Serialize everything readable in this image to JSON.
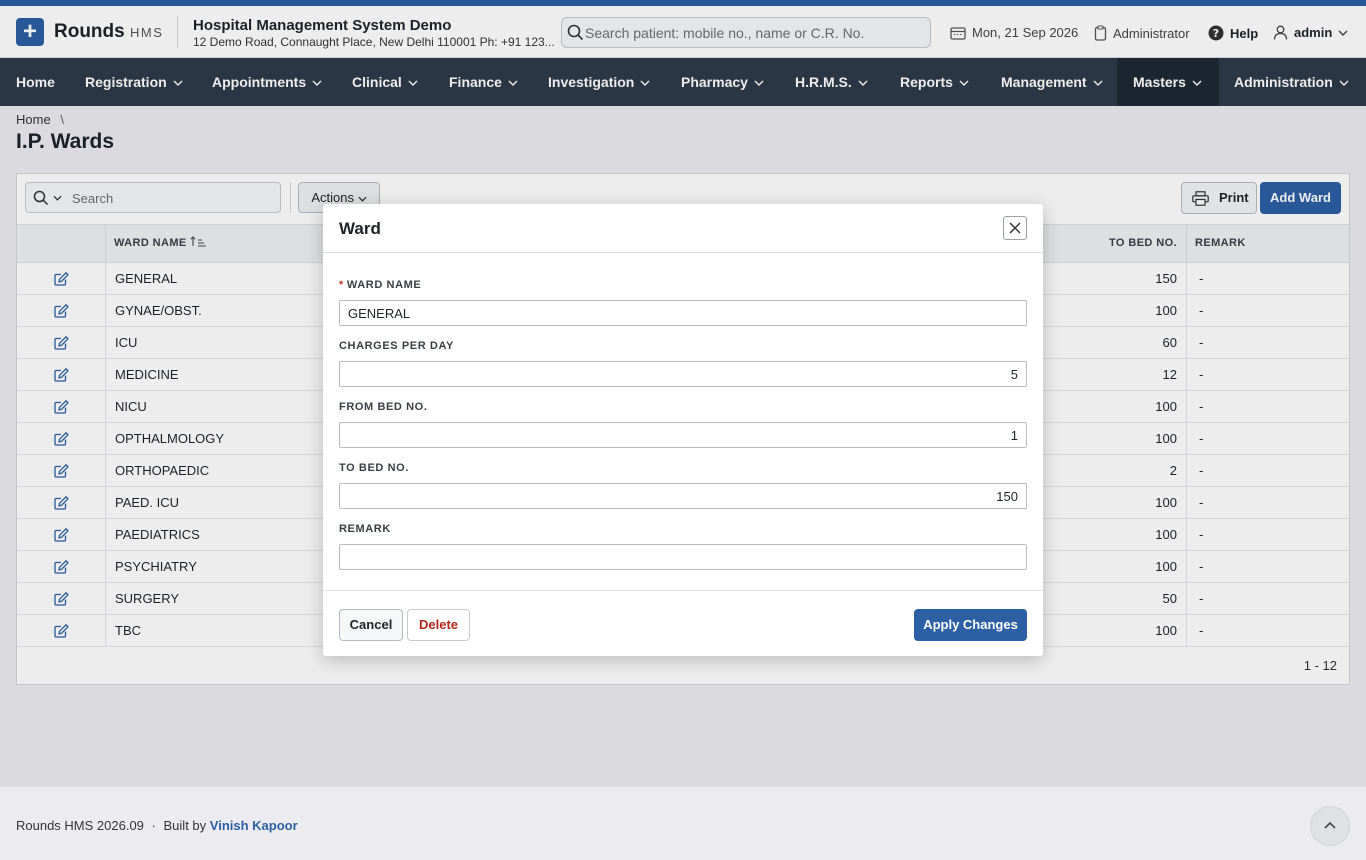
{
  "header": {
    "brand": "Rounds",
    "brand_sub": "HMS",
    "org_title": "Hospital Management System Demo",
    "org_address": "12 Demo Road, Connaught Place, New Delhi 110001 Ph: +91 123...",
    "search_placeholder": "Search patient: mobile no., name or C.R. No.",
    "date": "Mon, 21 Sep 2026",
    "role": "Administrator",
    "help": "Help",
    "user": "admin",
    "accent_color": "#2c5fa3"
  },
  "nav": {
    "items": [
      "Home",
      "Registration",
      "Appointments",
      "Clinical",
      "Finance",
      "Investigation",
      "Pharmacy",
      "H.R.M.S.",
      "Reports",
      "Management",
      "Masters",
      "Administration"
    ],
    "active": "Masters"
  },
  "page": {
    "breadcrumb_home": "Home",
    "breadcrumb_sep": "\\",
    "title": "I.P. Wards"
  },
  "toolbar": {
    "search_placeholder": "Search",
    "actions_label": "Actions",
    "print_label": "Print",
    "add_label": "Add Ward"
  },
  "table": {
    "columns": [
      "WARD NAME",
      "TO BED NO.",
      "REMARK"
    ],
    "rows": [
      {
        "name": "GENERAL",
        "to_bed": "150",
        "remark": "-"
      },
      {
        "name": "GYNAE/OBST.",
        "to_bed": "100",
        "remark": "-"
      },
      {
        "name": "ICU",
        "to_bed": "60",
        "remark": "-"
      },
      {
        "name": "MEDICINE",
        "to_bed": "12",
        "remark": "-"
      },
      {
        "name": "NICU",
        "to_bed": "100",
        "remark": "-"
      },
      {
        "name": "OPTHALMOLOGY",
        "to_bed": "100",
        "remark": "-"
      },
      {
        "name": "ORTHOPAEDIC",
        "to_bed": "2",
        "remark": "-"
      },
      {
        "name": "PAED. ICU",
        "to_bed": "100",
        "remark": "-"
      },
      {
        "name": "PAEDIATRICS",
        "to_bed": "100",
        "remark": "-"
      },
      {
        "name": "PSYCHIATRY",
        "to_bed": "100",
        "remark": "-"
      },
      {
        "name": "SURGERY",
        "to_bed": "50",
        "remark": "-"
      },
      {
        "name": "TBC",
        "to_bed": "100",
        "remark": "-"
      }
    ],
    "pagination": "1 - 12"
  },
  "modal": {
    "title": "Ward",
    "required_mark": "*",
    "ward_name_label": "WARD NAME",
    "ward_name_value": "GENERAL",
    "charges_label": "CHARGES PER DAY",
    "charges_value": "5",
    "from_bed_label": "FROM BED NO.",
    "from_bed_value": "1",
    "to_bed_label": "TO BED NO.",
    "to_bed_value": "150",
    "remark_label": "REMARK",
    "remark_value": "",
    "cancel_label": "Cancel",
    "delete_label": "Delete",
    "apply_label": "Apply Changes"
  },
  "footer": {
    "version": "Rounds HMS 2026.09",
    "dot": "·",
    "built_by": "Built by",
    "author": "Vinish Kapoor"
  }
}
